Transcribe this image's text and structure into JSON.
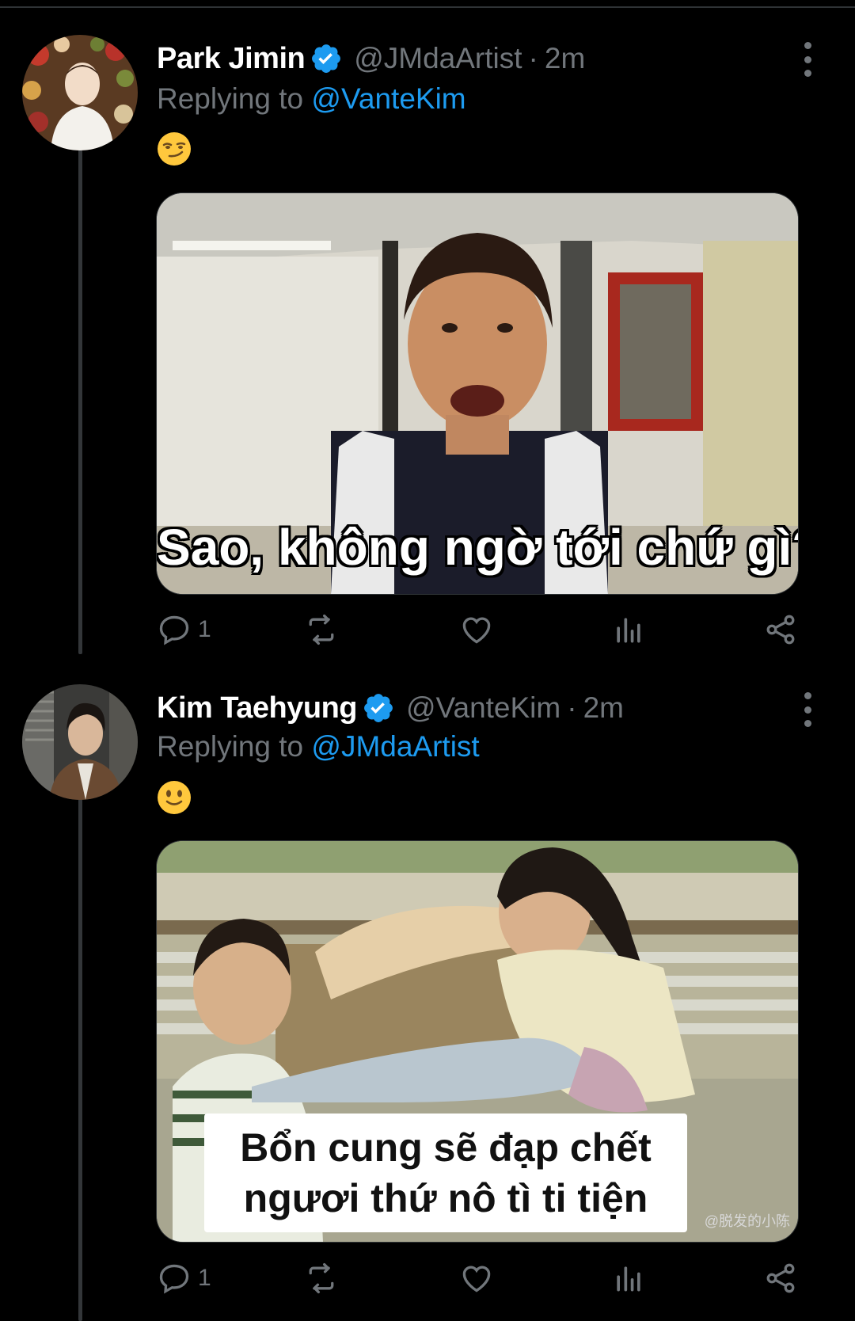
{
  "tweets": [
    {
      "display_name": "Park Jimin",
      "handle": "@JMdaArtist",
      "separator": "·",
      "time": "2m",
      "replying_prefix": "Replying to ",
      "replying_to": "@VanteKim",
      "emoji": "smirking-face",
      "media_caption": "Sao, không ngờ tới chứ gì?",
      "reply_count": "1"
    },
    {
      "display_name": "Kim Taehyung",
      "handle": "@VanteKim",
      "separator": "·",
      "time": "2m",
      "replying_prefix": "Replying to ",
      "replying_to": "@JMdaArtist",
      "emoji": "slightly-smiling-face",
      "media_caption_line1": "Bổn cung sẽ đạp chết",
      "media_caption_line2": "ngươi thứ nô tì ti tiện",
      "media_watermark": "@脱发的小陈",
      "reply_count": "1"
    }
  ],
  "icons": [
    "verified-badge-icon",
    "more-options-icon",
    "reply-icon",
    "retweet-icon",
    "like-icon",
    "views-icon",
    "share-icon"
  ],
  "colors": {
    "background": "#000000",
    "primary_text": "#ffffff",
    "secondary_text": "#71767b",
    "accent": "#1d9bf0",
    "thread_line": "#333639"
  }
}
